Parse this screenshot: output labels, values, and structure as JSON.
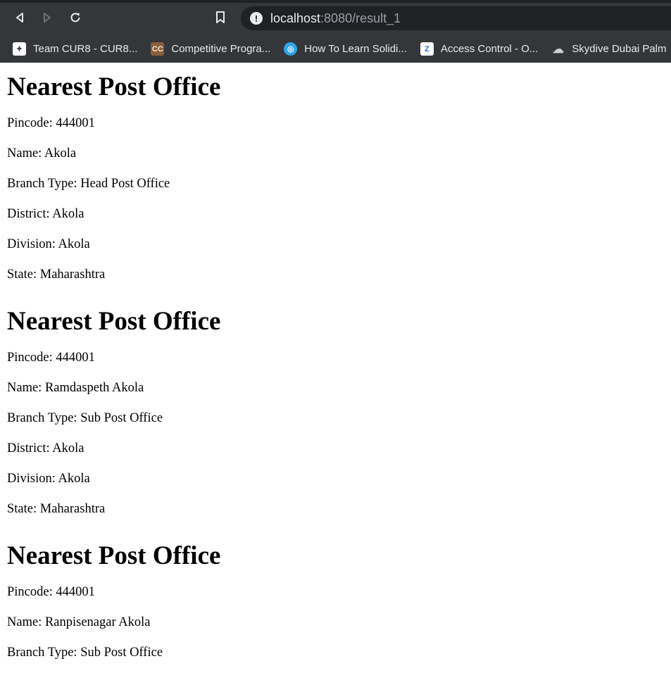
{
  "browser": {
    "url_host": "localhost",
    "url_path": ":8080/result_1",
    "bookmarks": [
      {
        "label": "Team CUR8 - CUR8...",
        "icon": "sparkle-icon",
        "color": "#ffffff"
      },
      {
        "label": "Competitive Progra...",
        "icon": "codechef-icon",
        "color": "#8b5e3c"
      },
      {
        "label": "How To Learn Solidi...",
        "icon": "globe-icon",
        "color": "#2fa4e7"
      },
      {
        "label": "Access Control - O...",
        "icon": "z-icon",
        "color": "#ffffff"
      },
      {
        "label": "Skydive Dubai Palm",
        "icon": "cloud-icon",
        "color": "#cfd2d6"
      }
    ]
  },
  "labels": {
    "pincode": "Pincode: ",
    "name": "Name: ",
    "branch_type": "Branch Type: ",
    "district": "District: ",
    "division": "Division: ",
    "state": "State: "
  },
  "offices": [
    {
      "heading": "Nearest Post Office",
      "pincode": "444001",
      "name": "Akola",
      "branch_type": "Head Post Office",
      "district": "Akola",
      "division": "Akola",
      "state": "Maharashtra"
    },
    {
      "heading": "Nearest Post Office",
      "pincode": "444001",
      "name": "Ramdaspeth Akola",
      "branch_type": "Sub Post Office",
      "district": "Akola",
      "division": "Akola",
      "state": "Maharashtra"
    },
    {
      "heading": "Nearest Post Office",
      "pincode": "444001",
      "name": "Ranpisenagar Akola",
      "branch_type": "Sub Post Office"
    }
  ]
}
